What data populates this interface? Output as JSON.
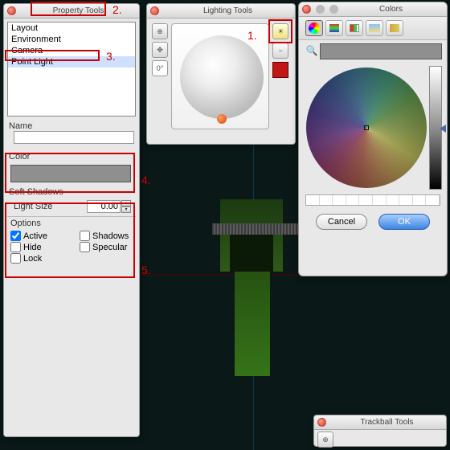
{
  "propertyTools": {
    "title": "Property Tools",
    "list": [
      "Layout",
      "Environment",
      "Camera",
      "Point Light"
    ],
    "selectedIndex": 3,
    "nameLabel": "Name",
    "nameValue": "",
    "colorLabel": "Color",
    "softShadowsLabel": "Soft Shadows",
    "lightSizeLabel": "Light Size",
    "lightSizeValue": "0.00",
    "optionsLabel": "Options",
    "options": {
      "active": {
        "label": "Active",
        "checked": true
      },
      "shadows": {
        "label": "Shadows",
        "checked": false
      },
      "hide": {
        "label": "Hide",
        "checked": false
      },
      "specular": {
        "label": "Specular",
        "checked": false
      },
      "lock": {
        "label": "Lock",
        "checked": false
      }
    }
  },
  "lightingTools": {
    "title": "Lighting Tools",
    "rot_label": "0°",
    "addIcon": "add-light-icon",
    "removeIcon": "remove-light-icon",
    "swatchColor": "#c21515"
  },
  "colorsPanel": {
    "title": "Colors",
    "cancelLabel": "Cancel",
    "okLabel": "OK"
  },
  "trackball": {
    "title": "Trackball Tools"
  },
  "annotations": {
    "a1": "1.",
    "a2": "2.",
    "a3": "3.",
    "a4": "4.",
    "a5": "5."
  }
}
